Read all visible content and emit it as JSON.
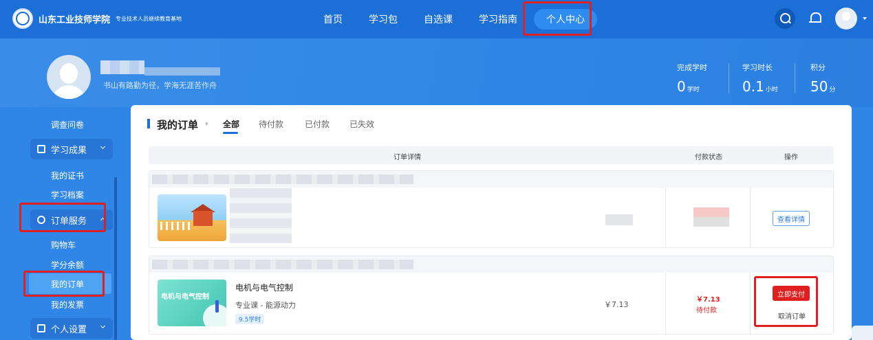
{
  "header": {
    "school_name": "山东工业技师学院",
    "school_sub": "专业技术人员继续教育基地",
    "nav": [
      "首页",
      "学习包",
      "自选课",
      "学习指南",
      "个人中心"
    ],
    "active_nav": "个人中心",
    "icons": [
      "search-icon",
      "bell-icon",
      "avatar-icon",
      "chevron-down-icon"
    ]
  },
  "profile": {
    "motto": "书山有路勤为径，学海无涯苦作舟",
    "stats": [
      {
        "label": "完成学时",
        "value": "0",
        "unit": "学时"
      },
      {
        "label": "学习时长",
        "value": "0.1",
        "unit": "小时"
      },
      {
        "label": "积分",
        "value": "50",
        "unit": "分"
      }
    ]
  },
  "sidebar": {
    "survey": "调查问卷",
    "group_results": "学习成果",
    "certificates": "我的证书",
    "archive": "学习档案",
    "group_orders": "订单服务",
    "cart": "购物车",
    "credit_balance": "学分余额",
    "my_orders": "我的订单",
    "invoices": "我的发票",
    "group_settings": "个人设置"
  },
  "main": {
    "title": "我的订单",
    "tabs": [
      "全部",
      "待付款",
      "已付款",
      "已失效"
    ],
    "active_tab": "全部",
    "columns": {
      "details": "订单详情",
      "status": "付款状态",
      "action": "操作"
    },
    "order1": {
      "action": "查看详情"
    },
    "order2": {
      "course_title": "电机与电气控制",
      "thumb_text": "电机与电气控制",
      "category": "专业课 - 能源动力",
      "hours": "9.5学时",
      "price": "￥7.13",
      "pay_amount": "￥7.13",
      "pay_status": "待付款",
      "pay_button": "立即支付",
      "cancel_button": "取消订单"
    }
  },
  "colors": {
    "primary": "#1b6fd6",
    "banner": "#2f86e6",
    "danger": "#e02020",
    "highlight_box": "#e02020"
  }
}
